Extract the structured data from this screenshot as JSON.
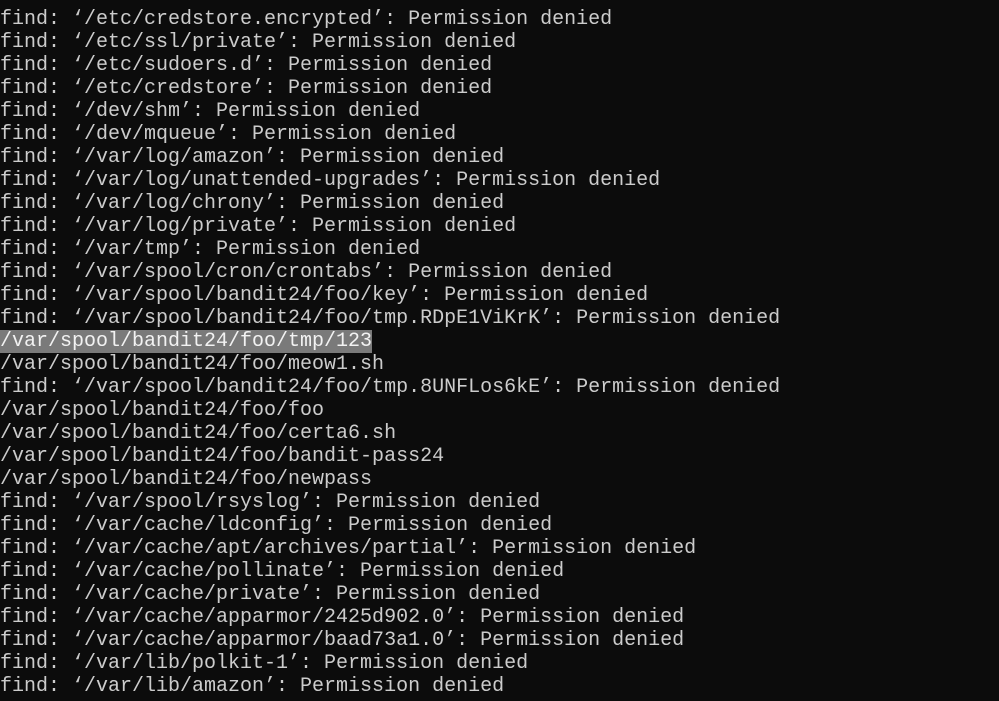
{
  "terminal": {
    "colors": {
      "background": "#0c0c0c",
      "foreground": "#cccccc",
      "selection": "#7a7a7a"
    },
    "selected_line_index": 14,
    "lines": [
      "find: ‘/etc/credstore.encrypted’: Permission denied",
      "find: ‘/etc/ssl/private’: Permission denied",
      "find: ‘/etc/sudoers.d’: Permission denied",
      "find: ‘/etc/credstore’: Permission denied",
      "find: ‘/dev/shm’: Permission denied",
      "find: ‘/dev/mqueue’: Permission denied",
      "find: ‘/var/log/amazon’: Permission denied",
      "find: ‘/var/log/unattended-upgrades’: Permission denied",
      "find: ‘/var/log/chrony’: Permission denied",
      "find: ‘/var/log/private’: Permission denied",
      "find: ‘/var/tmp’: Permission denied",
      "find: ‘/var/spool/cron/crontabs’: Permission denied",
      "find: ‘/var/spool/bandit24/foo/key’: Permission denied",
      "find: ‘/var/spool/bandit24/foo/tmp.RDpE1ViKrK’: Permission denied",
      "/var/spool/bandit24/foo/tmp/123",
      "/var/spool/bandit24/foo/meow1.sh",
      "find: ‘/var/spool/bandit24/foo/tmp.8UNFLos6kE’: Permission denied",
      "/var/spool/bandit24/foo/foo",
      "/var/spool/bandit24/foo/certa6.sh",
      "/var/spool/bandit24/foo/bandit-pass24",
      "/var/spool/bandit24/foo/newpass",
      "find: ‘/var/spool/rsyslog’: Permission denied",
      "find: ‘/var/cache/ldconfig’: Permission denied",
      "find: ‘/var/cache/apt/archives/partial’: Permission denied",
      "find: ‘/var/cache/pollinate’: Permission denied",
      "find: ‘/var/cache/private’: Permission denied",
      "find: ‘/var/cache/apparmor/2425d902.0’: Permission denied",
      "find: ‘/var/cache/apparmor/baad73a1.0’: Permission denied",
      "find: ‘/var/lib/polkit-1’: Permission denied",
      "find: ‘/var/lib/amazon’: Permission denied"
    ]
  }
}
